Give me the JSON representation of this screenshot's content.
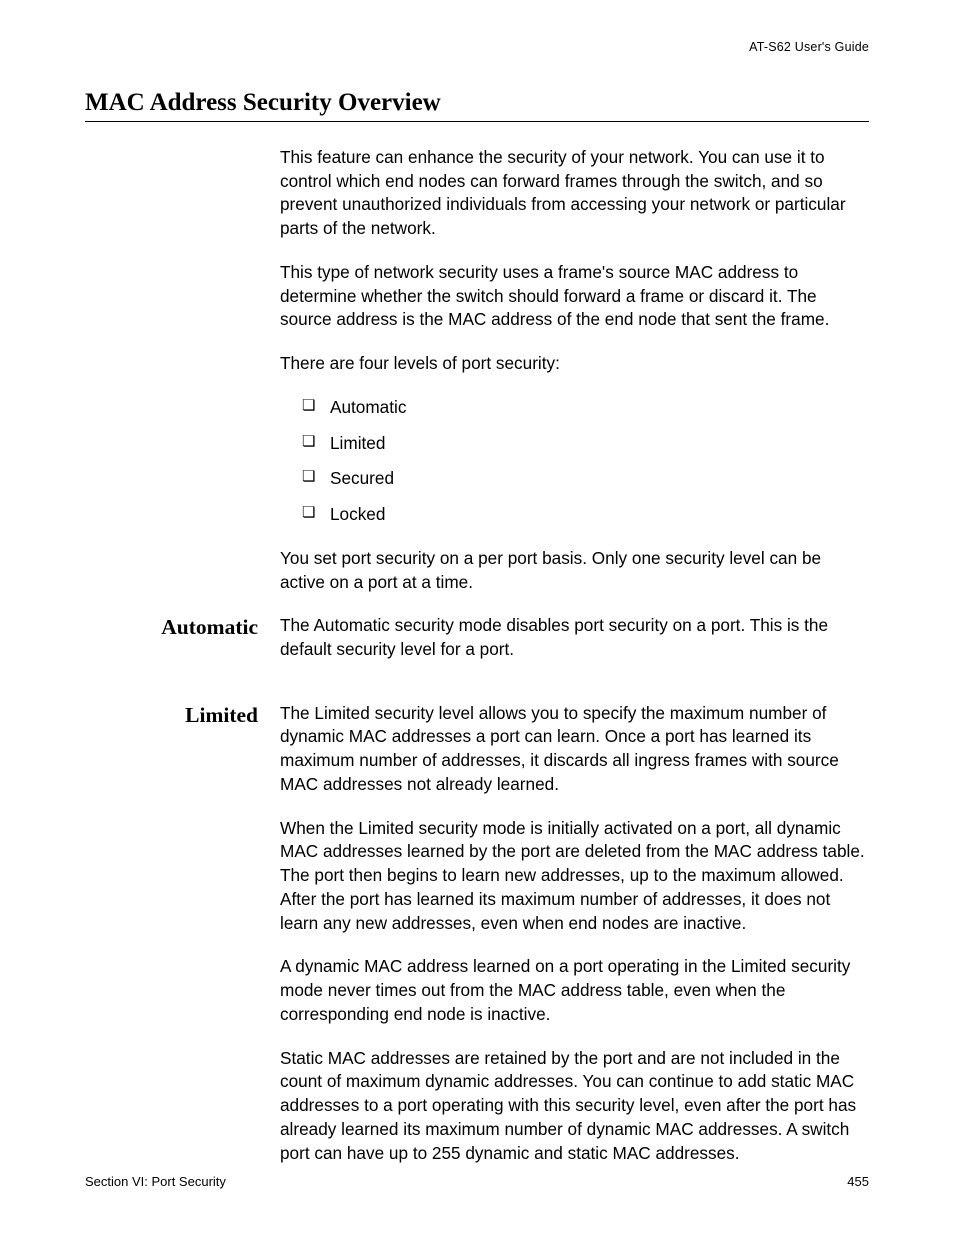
{
  "header": {
    "guide_title": "AT-S62 User's Guide"
  },
  "title": "MAC Address Security Overview",
  "intro": {
    "p1": "This feature can enhance the security of your network. You can use it to control which end nodes can forward frames through the switch, and so prevent unauthorized individuals from accessing your network or particular parts of the network.",
    "p2": "This type of network security uses a frame's source MAC address to determine whether the switch should forward a frame or discard it. The source address is the MAC address of the end node that sent the frame.",
    "p3": "There are four levels of port security:",
    "levels": [
      "Automatic",
      "Limited",
      "Secured",
      "Locked"
    ],
    "p4": "You set port security on a per port basis. Only one security level can be active on a port at a time."
  },
  "sections": {
    "automatic": {
      "heading": "Automatic",
      "p1": "The Automatic security mode disables port security on a port. This is the default security level for a port."
    },
    "limited": {
      "heading": "Limited",
      "p1": "The Limited security level allows you to specify the maximum number of dynamic MAC addresses a port can learn. Once a port has learned its maximum number of addresses, it discards all ingress frames with source MAC addresses not already learned.",
      "p2": "When the Limited security mode is initially activated on a port, all dynamic MAC addresses learned by the port are deleted from the MAC address table. The port then begins to learn new addresses, up to the maximum allowed. After the port has learned its maximum number of addresses, it does not learn any new addresses, even when end nodes are inactive.",
      "p3": "A dynamic MAC address learned on a port operating in the Limited security mode never times out from the MAC address table, even when the corresponding end node is inactive.",
      "p4": "Static MAC addresses are retained by the port and are not included in the count of maximum dynamic addresses. You can continue to add static MAC addresses to a port operating with this security level, even after the port has already learned its maximum number of dynamic MAC addresses. A switch port can have up to 255 dynamic and static MAC addresses."
    }
  },
  "footer": {
    "section_label": "Section VI: Port Security",
    "page_number": "455"
  }
}
